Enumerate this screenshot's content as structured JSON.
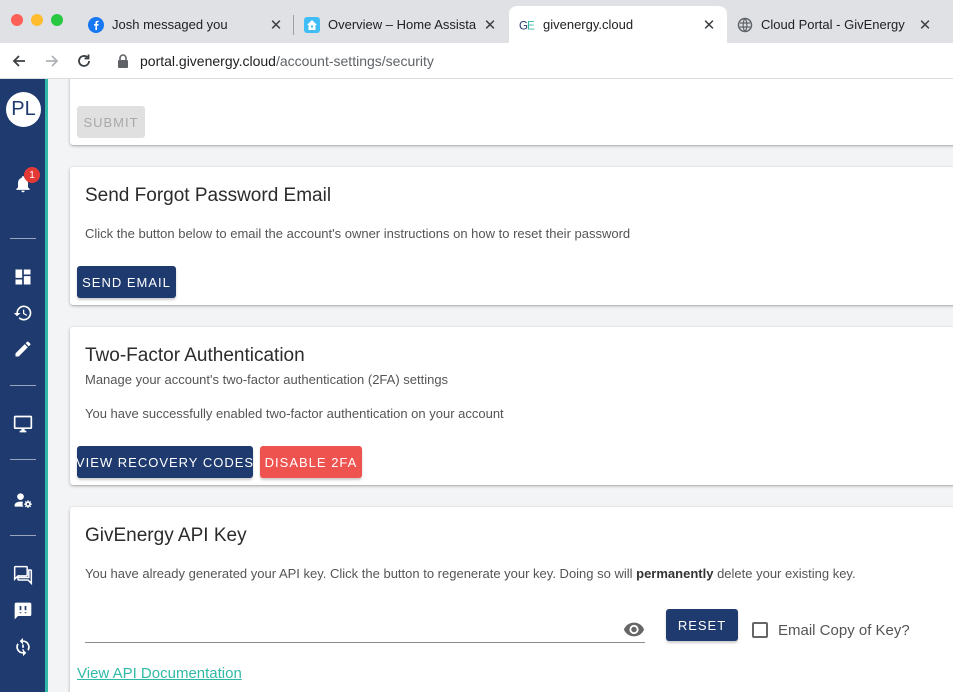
{
  "browser": {
    "tabs": [
      {
        "title": "Josh messaged you",
        "active": false
      },
      {
        "title": "Overview – Home Assistant",
        "active": false
      },
      {
        "title": "givenergy.cloud",
        "active": true
      },
      {
        "title": "Cloud Portal - GivEnergy",
        "active": false
      }
    ],
    "url_host": "portal.givenergy.cloud",
    "url_path": "/account-settings/security"
  },
  "sidebar": {
    "avatar_initials": "PL",
    "notification_count": "1"
  },
  "password_card": {
    "submit_label": "SUBMIT"
  },
  "forgot_card": {
    "title": "Send Forgot Password Email",
    "description": "Click the button below to email the account's owner instructions on how to reset their password",
    "send_label": "SEND EMAIL"
  },
  "twofa_card": {
    "title": "Two-Factor Authentication",
    "subtitle": "Manage your account's two-factor authentication (2FA) settings",
    "status": "You have successfully enabled two-factor authentication on your account",
    "recovery_label": "VIEW RECOVERY CODES",
    "disable_label": "DISABLE 2FA"
  },
  "api_card": {
    "title": "GivEnergy API Key",
    "desc_before": "You have already generated your API key. Click the button to regenerate your key. Doing so will ",
    "desc_bold": "permanently",
    "desc_after": " delete your existing key.",
    "key_value": "",
    "reset_label": "RESET",
    "email_copy_label": "Email Copy of Key?",
    "doc_link": "View API Documentation"
  },
  "colors": {
    "primary": "#1e3a6e",
    "accent": "#30b9a6",
    "danger": "#ef5350"
  }
}
